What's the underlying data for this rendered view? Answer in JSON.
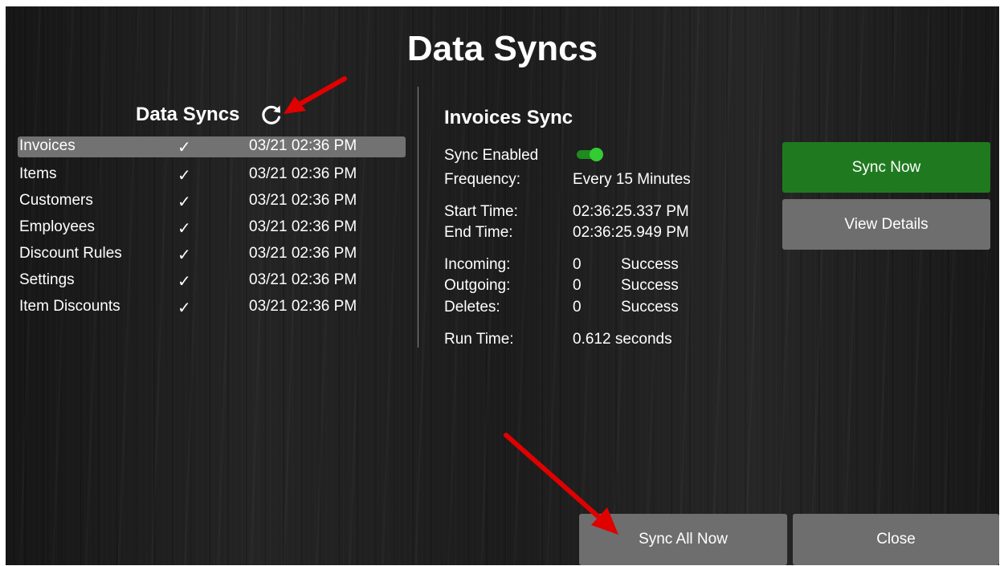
{
  "title": "Data Syncs",
  "list": {
    "heading": "Data Syncs",
    "refresh_icon": "refresh-icon",
    "check_icon": "checkmark-icon",
    "items": [
      {
        "name": "Invoices",
        "check": "✓",
        "time": "03/21 02:36 PM",
        "selected": true
      },
      {
        "name": "Items",
        "check": "✓",
        "time": "03/21 02:36 PM"
      },
      {
        "name": "Customers",
        "check": "✓",
        "time": "03/21 02:36 PM"
      },
      {
        "name": "Employees",
        "check": "✓",
        "time": "03/21 02:36 PM"
      },
      {
        "name": "Discount Rules",
        "check": "✓",
        "time": "03/21 02:36 PM"
      },
      {
        "name": "Settings",
        "check": "✓",
        "time": "03/21 02:36 PM"
      },
      {
        "name": "Item Discounts",
        "check": "✓",
        "time": "03/21 02:36 PM"
      }
    ]
  },
  "detail": {
    "title": "Invoices Sync",
    "sync_enabled_label": "Sync Enabled",
    "sync_enabled": true,
    "frequency_label": "Frequency:",
    "frequency": "Every 15 Minutes",
    "start_label": "Start Time:",
    "start": "02:36:25.337 PM",
    "end_label": "End Time:",
    "end": "02:36:25.949 PM",
    "incoming_label": "Incoming:",
    "incoming_count": "0",
    "incoming_status": "Success",
    "outgoing_label": "Outgoing:",
    "outgoing_count": "0",
    "outgoing_status": "Success",
    "deletes_label": "Deletes:",
    "deletes_count": "0",
    "deletes_status": "Success",
    "runtime_label": "Run Time:",
    "runtime": "0.612 seconds"
  },
  "buttons": {
    "sync_now": "Sync Now",
    "view_details": "View Details",
    "sync_all": "Sync All Now",
    "close": "Close"
  },
  "colors": {
    "accent_green": "#1f7a1f",
    "toggle_on": "#33cc33",
    "button_gray": "#6e6e6e",
    "annotation_red": "#e00000"
  }
}
